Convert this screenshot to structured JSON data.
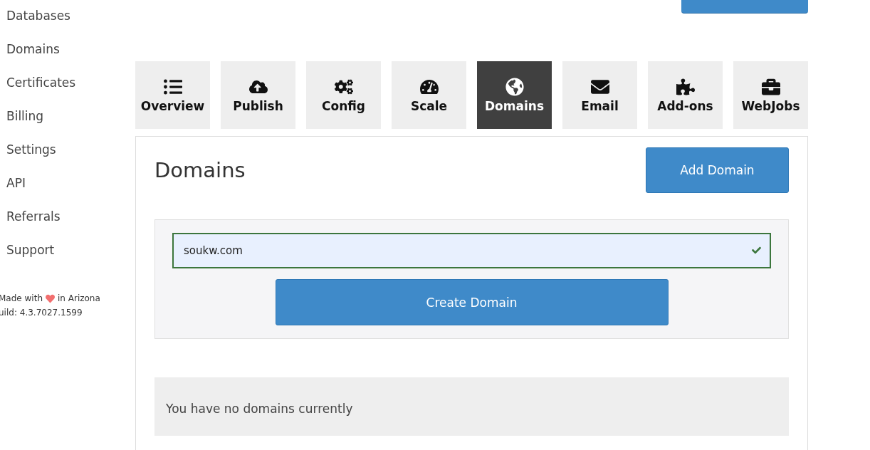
{
  "sidebar": {
    "items": [
      {
        "label": "Databases"
      },
      {
        "label": "Domains"
      },
      {
        "label": "Certificates"
      },
      {
        "label": "Billing"
      },
      {
        "label": "Settings"
      },
      {
        "label": "API"
      },
      {
        "label": "Referrals"
      },
      {
        "label": "Support"
      }
    ],
    "footer": {
      "made_prefix": "Made with",
      "made_suffix": "in Arizona",
      "build": "uild: 4.3.7027.1599"
    }
  },
  "tabs": [
    {
      "label": "Overview",
      "selected": false
    },
    {
      "label": "Publish",
      "selected": false
    },
    {
      "label": "Config",
      "selected": false
    },
    {
      "label": "Scale",
      "selected": false
    },
    {
      "label": "Domains",
      "selected": true
    },
    {
      "label": "Email",
      "selected": false
    },
    {
      "label": "Add-ons",
      "selected": false
    },
    {
      "label": "WebJobs",
      "selected": false
    }
  ],
  "panel": {
    "title": "Domains",
    "add_button": "Add Domain",
    "form": {
      "value": "soukw.com",
      "valid": true,
      "submit": "Create Domain"
    },
    "empty_message": "You have no domains currently"
  }
}
